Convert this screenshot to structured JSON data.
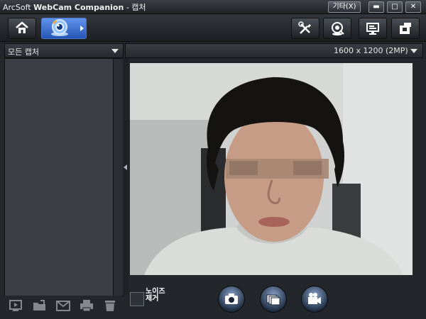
{
  "window": {
    "title_prefix": "ArcSoft",
    "title_app": "WebCam Companion",
    "title_suffix": "- 캡처",
    "etc_button": "기타(X)",
    "min_glyph": "▬",
    "max_glyph": "□",
    "close_glyph": "✕"
  },
  "toolbar": {
    "items": [
      "home-icon",
      "capture-webcam-icon",
      "tools-icon",
      "webcam-settings-icon",
      "monitor-icon",
      "share-icon"
    ]
  },
  "left_panel": {
    "filter_label": "모든 캡처"
  },
  "right_panel": {
    "resolution": "1600 x 1200 (2MP)"
  },
  "noise_reduction": {
    "label": "노이즈\n제거",
    "checked": false
  },
  "bottom_left_icons": [
    "slideshow-icon",
    "open-folder-icon",
    "email-icon",
    "print-icon",
    "trash-icon"
  ],
  "capture_buttons": [
    "camera-icon",
    "burst-icon",
    "video-icon"
  ],
  "colors": {
    "accent": "#2f6fd6"
  }
}
